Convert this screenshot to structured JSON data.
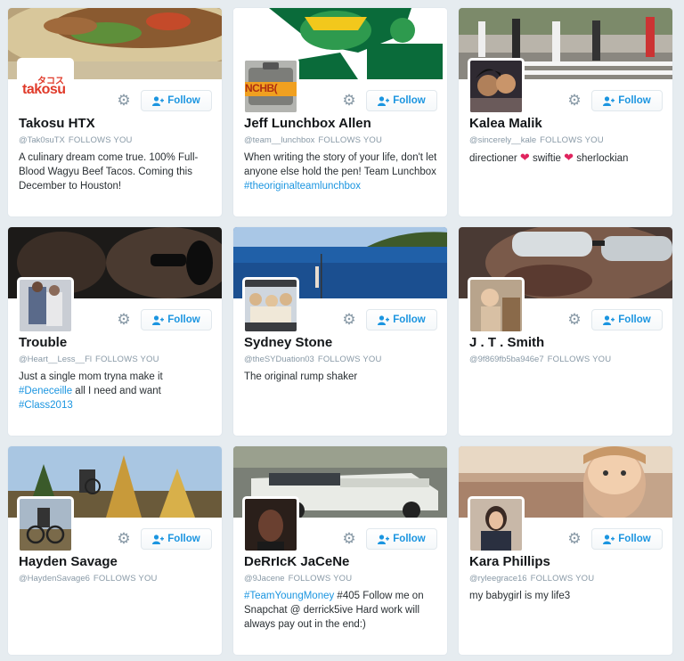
{
  "follow_label": "Follow",
  "follows_you": "FOLLOWS YOU",
  "colors": {
    "accent": "#1b95e0",
    "heart": "#e0245e"
  },
  "cards": [
    {
      "name": "Takosu HTX",
      "handle": "@Tak0suTX",
      "bio": "A culinary dream come true. 100% Full-Blood Wagyu Beef Tacos. Coming this December to Houston!",
      "logo_text_jp": "タコス",
      "logo_text": "takosu"
    },
    {
      "name": "Jeff Lunchbox Allen",
      "handle": "@team__lunchbox",
      "bio_parts": [
        "When writing the story of your life, don't let anyone else hold the pen! Team Lunchbox ",
        "#theoriginalteamlunchbox"
      ],
      "avatar_text": "NCHB("
    },
    {
      "name": "Kalea Malik",
      "handle": "@sincerely__kale",
      "bio_parts": [
        "directioner ",
        "swiftie ",
        "sherlockian"
      ]
    },
    {
      "name": "Trouble",
      "handle": "@Heart__Less__Fl",
      "bio_parts": [
        "Just a single mom tryna make it ",
        "#Deneceille",
        " all I need and want ",
        "#Class2013"
      ]
    },
    {
      "name": "Sydney Stone",
      "handle": "@theSYDuation03",
      "bio": "The original rump shaker"
    },
    {
      "name": "J . T . Smith",
      "handle": "@9f869fb5ba946e7",
      "bio": ""
    },
    {
      "name": "Hayden Savage",
      "handle": "@HaydenSavage6",
      "bio": ""
    },
    {
      "name": "DeRrIcK JaCeNe",
      "handle": "@9Jacene",
      "bio_parts": [
        "#TeamYoungMoney",
        " #405 Follow me on Snapchat @ derrick5ive Hard work will always pay out in the end:)"
      ]
    },
    {
      "name": "Kara Phillips",
      "handle": "@ryleegrace16",
      "bio": "my babygirl is my life3"
    }
  ]
}
